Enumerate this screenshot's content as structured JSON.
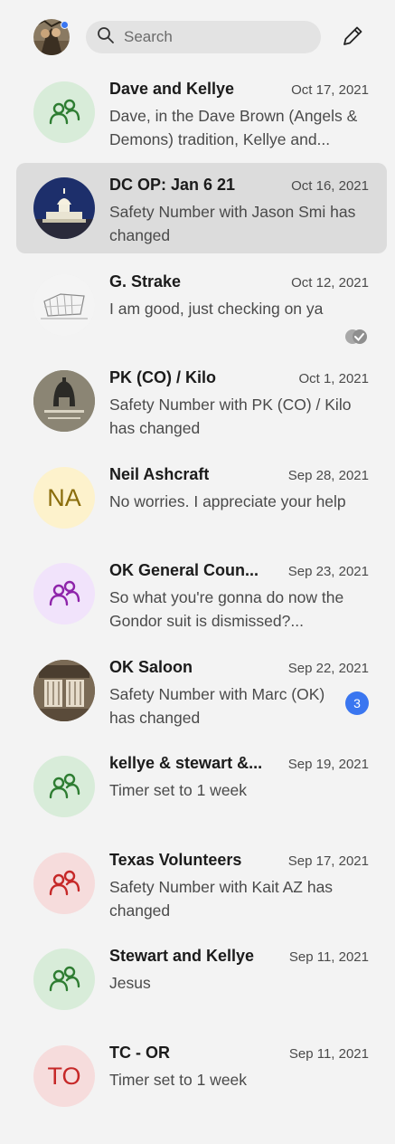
{
  "search": {
    "placeholder": "Search"
  },
  "colors": {
    "accent": "#3a76f0",
    "selected_row": "#dcdcdc",
    "background": "#f3f3f3"
  },
  "conversations": [
    {
      "name": "Dave and Kellye",
      "date": "Oct 17, 2021",
      "snippet": "Dave, in the Dave Brown (Angels & Demons) tradition, Kellye and...",
      "avatar": "group-icon",
      "avatar_bg": "#d8ecd9",
      "avatar_fg": "#2e7d32"
    },
    {
      "name": "DC OP: Jan 6 21",
      "date": "Oct 16, 2021",
      "snippet": "Safety Number with Jason Smi has changed",
      "avatar": "capitol-photo",
      "selected": true
    },
    {
      "name": "G. Strake",
      "date": "Oct 12, 2021",
      "snippet": "I am good, just checking on ya",
      "avatar": "sketch-photo",
      "status": "read-receipt-icon"
    },
    {
      "name": "PK (CO) / Kilo",
      "date": "Oct 1, 2021",
      "snippet": "Safety Number with PK (CO) / Kilo has changed",
      "avatar": "helmet-logo"
    },
    {
      "name": "Neil Ashcraft",
      "date": "Sep 28, 2021",
      "snippet": "No worries. I appreciate your help",
      "avatar_initials": "NA",
      "avatar_bg": "#fdf2cc",
      "avatar_fg": "#8a6d0b"
    },
    {
      "name": "OK General Coun...",
      "date": "Sep 23, 2021",
      "snippet": "So what you're gonna do now the Gondor suit is dismissed?...",
      "avatar": "group-icon",
      "avatar_bg": "#f1e3fb",
      "avatar_fg": "#8e24aa"
    },
    {
      "name": "OK Saloon",
      "date": "Sep 22, 2021",
      "snippet": "Safety Number with Marc (OK) has changed",
      "avatar": "saloon-photo",
      "unread": "3"
    },
    {
      "name": "kellye & stewart &...",
      "date": "Sep 19, 2021",
      "snippet": "Timer set to 1 week",
      "avatar": "group-icon",
      "avatar_bg": "#d8ecd9",
      "avatar_fg": "#2e7d32"
    },
    {
      "name": "Texas Volunteers",
      "date": "Sep 17, 2021",
      "snippet": "Safety Number with Kait AZ has changed",
      "avatar": "group-icon",
      "avatar_bg": "#f6dcdc",
      "avatar_fg": "#c62828"
    },
    {
      "name": "Stewart and Kellye",
      "date": "Sep 11, 2021",
      "snippet": "Jesus",
      "avatar": "group-icon",
      "avatar_bg": "#d8ecd9",
      "avatar_fg": "#2e7d32"
    },
    {
      "name": "TC - OR",
      "date": "Sep 11, 2021",
      "snippet": "Timer set to 1 week",
      "avatar_initials": "TO",
      "avatar_bg": "#f6dcdc",
      "avatar_fg": "#c62828"
    }
  ]
}
